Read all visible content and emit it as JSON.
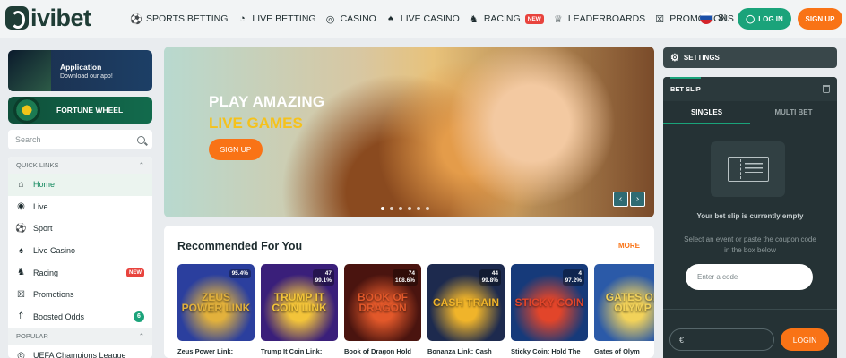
{
  "header": {
    "logo_text": "ivibet",
    "nav": [
      {
        "label": "SPORTS BETTING",
        "icon": "soccer-ball-icon"
      },
      {
        "label": "LIVE BETTING",
        "icon": "live-betting-icon"
      },
      {
        "label": "CASINO",
        "icon": "casino-chip-icon"
      },
      {
        "label": "LIVE CASINO",
        "icon": "cards-icon"
      },
      {
        "label": "RACING",
        "icon": "horse-icon",
        "badge": "NEW"
      },
      {
        "label": "LEADERBOARDS",
        "icon": "trophy-icon"
      },
      {
        "label": "PROMOTIONS",
        "icon": "gift-icon"
      }
    ],
    "more": "•••",
    "language": "SI",
    "login_label": "LOG IN",
    "signup_label": "SIGN UP"
  },
  "sidebar": {
    "app_promo": {
      "title": "Application",
      "subtitle": "Download our app!"
    },
    "wheel_promo": {
      "title": "FORTUNE WHEEL"
    },
    "search_placeholder": "Search",
    "quick_links_title": "QUICK LINKS",
    "items": [
      {
        "label": "Home",
        "icon": "home-icon",
        "active": true
      },
      {
        "label": "Live",
        "icon": "broadcast-icon"
      },
      {
        "label": "Sport",
        "icon": "soccer-ball-icon"
      },
      {
        "label": "Live Casino",
        "icon": "cards-icon"
      },
      {
        "label": "Racing",
        "icon": "horse-icon",
        "badge": "NEW"
      },
      {
        "label": "Promotions",
        "icon": "gift-icon"
      },
      {
        "label": "Boosted Odds",
        "icon": "chevrons-up-icon",
        "count": "6"
      }
    ],
    "popular_title": "POPULAR",
    "popular_items": [
      {
        "label": "UEFA Champions League"
      }
    ]
  },
  "hero": {
    "line1": "PLAY AMAZING",
    "line2": "LIVE GAMES",
    "cta": "SIGN UP",
    "slide_count": 6,
    "active_slide": 0
  },
  "recommended": {
    "title": "Recommended For You",
    "more": "MORE",
    "games": [
      {
        "name": "Zeus Power Link:",
        "rtp": "95.4%",
        "players": "",
        "art": "ZEUS POWER LINK",
        "colors": [
          "#2b3f9e",
          "#e2b13c"
        ]
      },
      {
        "name": "Trump It Coin Link:",
        "rtp": "99.1%",
        "players": "47",
        "art": "TRUMP IT COIN LINK",
        "colors": [
          "#3a1f7a",
          "#f3c43a"
        ]
      },
      {
        "name": "Book of Dragon Hold",
        "rtp": "108.6%",
        "players": "74",
        "art": "BOOK OF DRAGON",
        "colors": [
          "#4a140f",
          "#e2582a"
        ]
      },
      {
        "name": "Bonanza Link: Cash",
        "rtp": "99.8%",
        "players": "44",
        "art": "CASH TRAIN",
        "colors": [
          "#1d2a4e",
          "#f0b42a"
        ]
      },
      {
        "name": "Sticky Coin: Hold The",
        "rtp": "97.2%",
        "players": "4",
        "art": "STICKY COIN",
        "colors": [
          "#163a7a",
          "#e2452a"
        ]
      },
      {
        "name": "Gates of Olym",
        "rtp": "",
        "players": "6",
        "art": "GATES OF OLYMP",
        "colors": [
          "#2b5aa8",
          "#f2d25a"
        ]
      }
    ]
  },
  "right": {
    "settings_label": "SETTINGS",
    "betslip_title": "BET SLIP",
    "tabs": [
      "SINGLES",
      "MULTI BET"
    ],
    "empty_text": "Your bet slip is currently empty",
    "hint_text": "Select an event or paste the coupon code in the box below",
    "code_placeholder": "Enter a code",
    "currency": "€",
    "login_label": "LOGIN"
  }
}
